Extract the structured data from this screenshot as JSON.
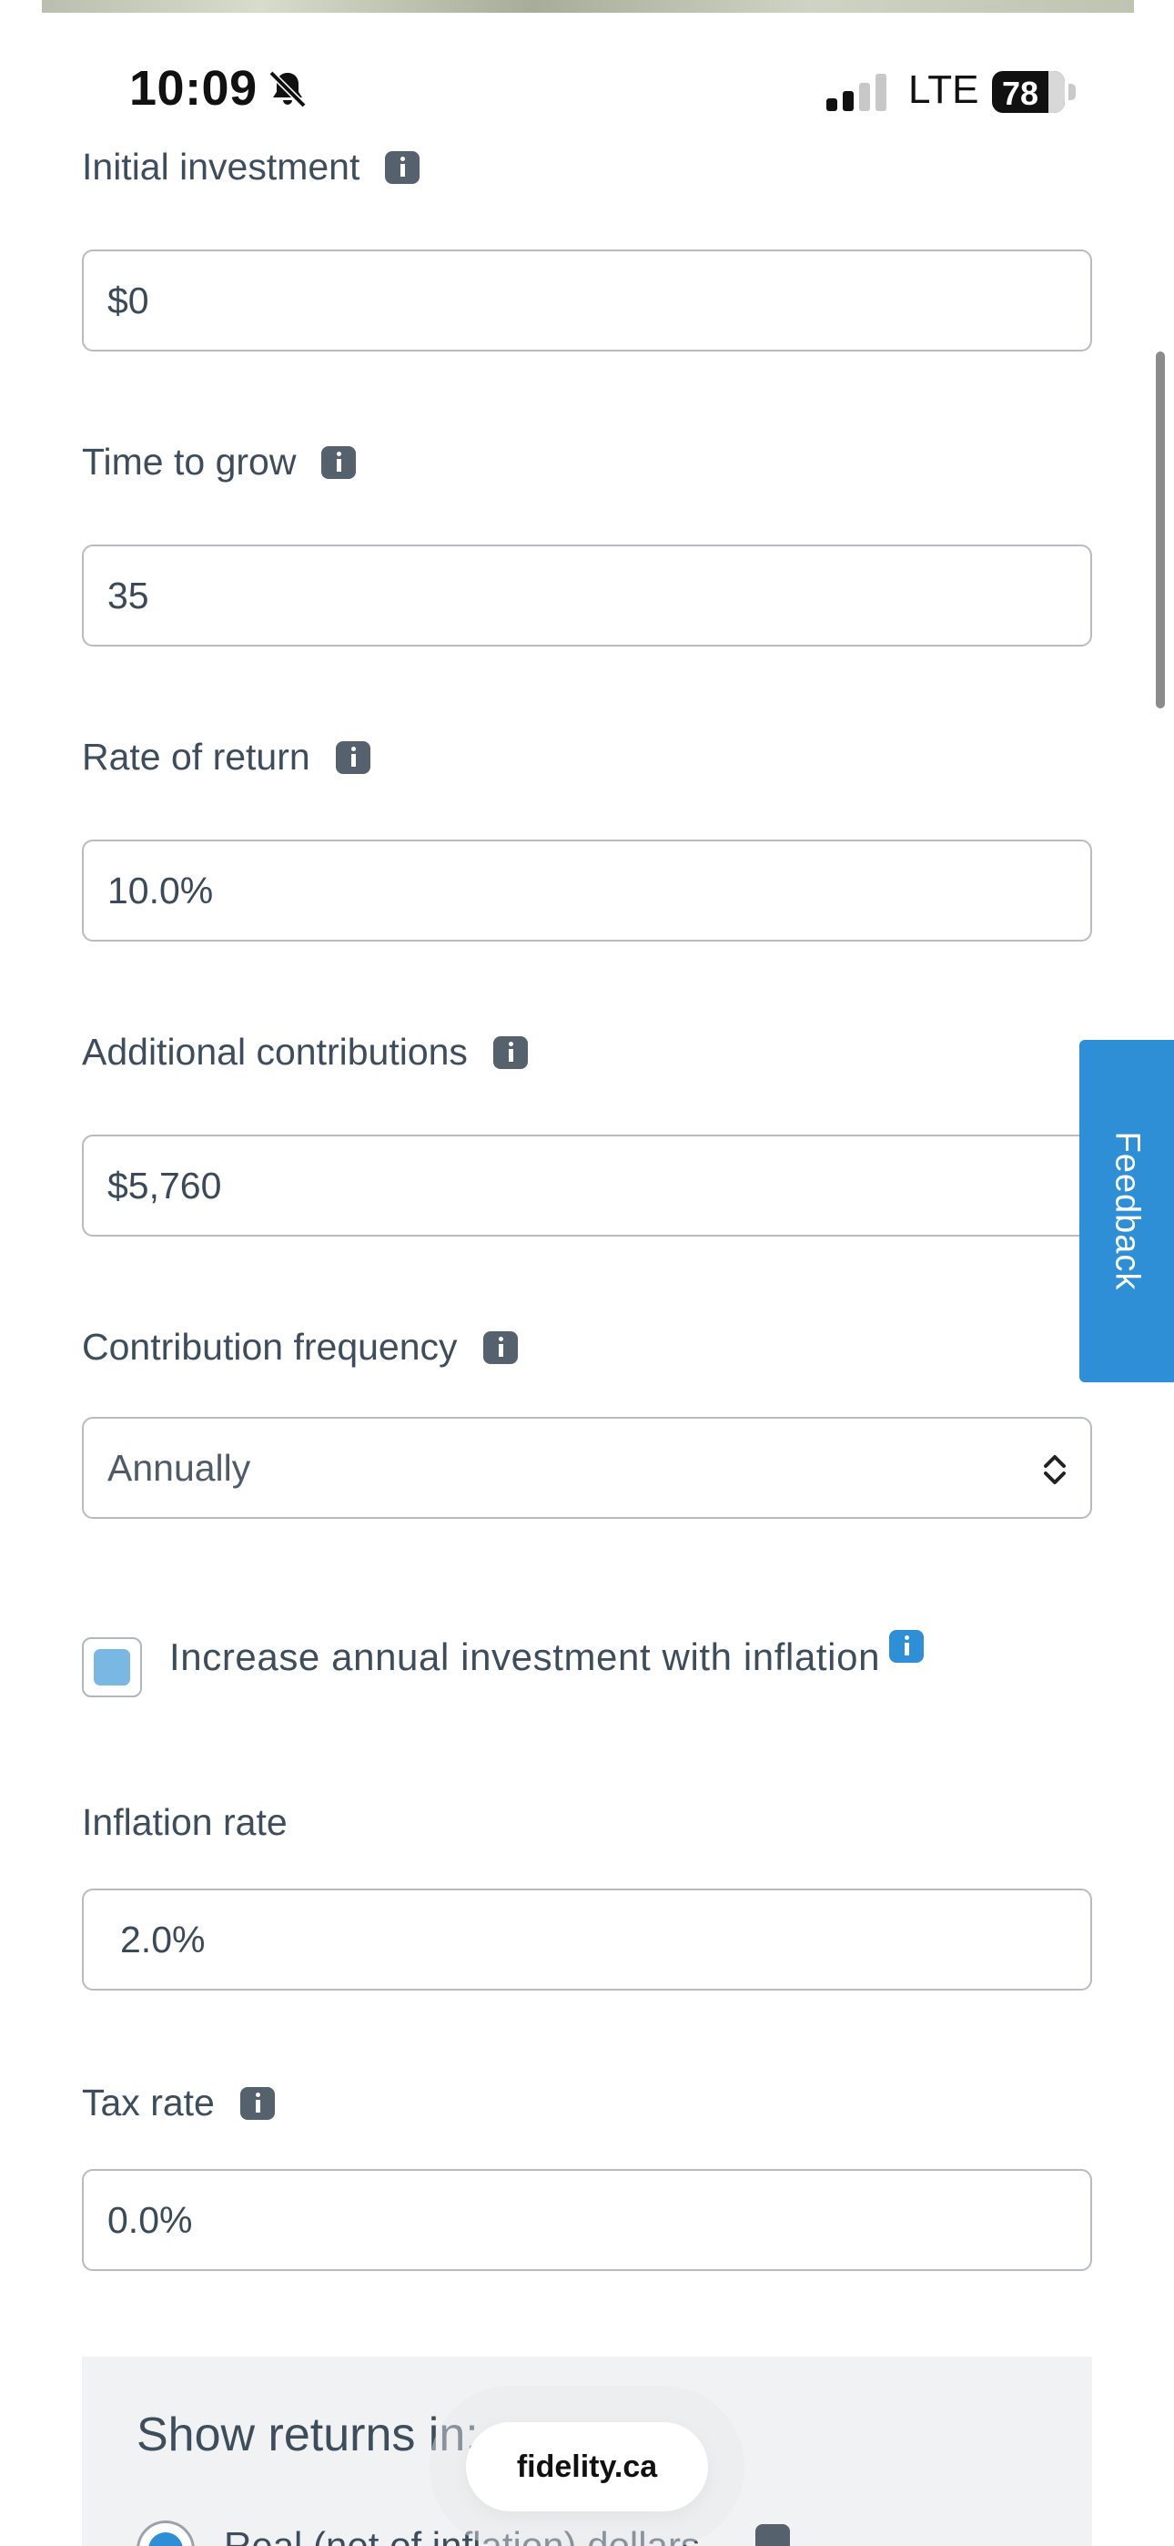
{
  "status_bar": {
    "time": "10:09",
    "network": "LTE",
    "battery_percent": "78",
    "battery_level": 0.78,
    "signal_bars_active": 2,
    "signal_bars_total": 4
  },
  "form": {
    "initial_investment": {
      "label": "Initial investment",
      "value": "$0"
    },
    "time_to_grow": {
      "label": "Time to grow",
      "value": "35"
    },
    "rate_of_return": {
      "label": "Rate of return",
      "value": "10.0%"
    },
    "additional_contributions": {
      "label": "Additional contributions",
      "value": "$5,760"
    },
    "contribution_frequency": {
      "label": "Contribution frequency",
      "selected": "Annually"
    },
    "increase_with_inflation": {
      "label": "Increase annual investment with inflation",
      "checked": true
    },
    "inflation_rate": {
      "label": "Inflation rate",
      "value": "2.0%"
    },
    "tax_rate": {
      "label": "Tax rate",
      "value": "0.0%"
    }
  },
  "returns_panel": {
    "heading": "Show returns in:",
    "option_partial": "Real (net of inflation) dollars"
  },
  "feedback_tab": {
    "label": "Feedback"
  },
  "browser": {
    "url": "fidelity.ca"
  },
  "icons": {
    "info": "info-icon",
    "bell_muted": "bell-slash-icon",
    "chevron": "chevron-up-down-icon"
  },
  "colors": {
    "accent_blue": "#2e8fd6",
    "checkbox_fill": "#7ab8e4",
    "text": "#3d4d5c",
    "input_border": "#b8bcc0",
    "panel_bg": "#f1f2f3"
  }
}
